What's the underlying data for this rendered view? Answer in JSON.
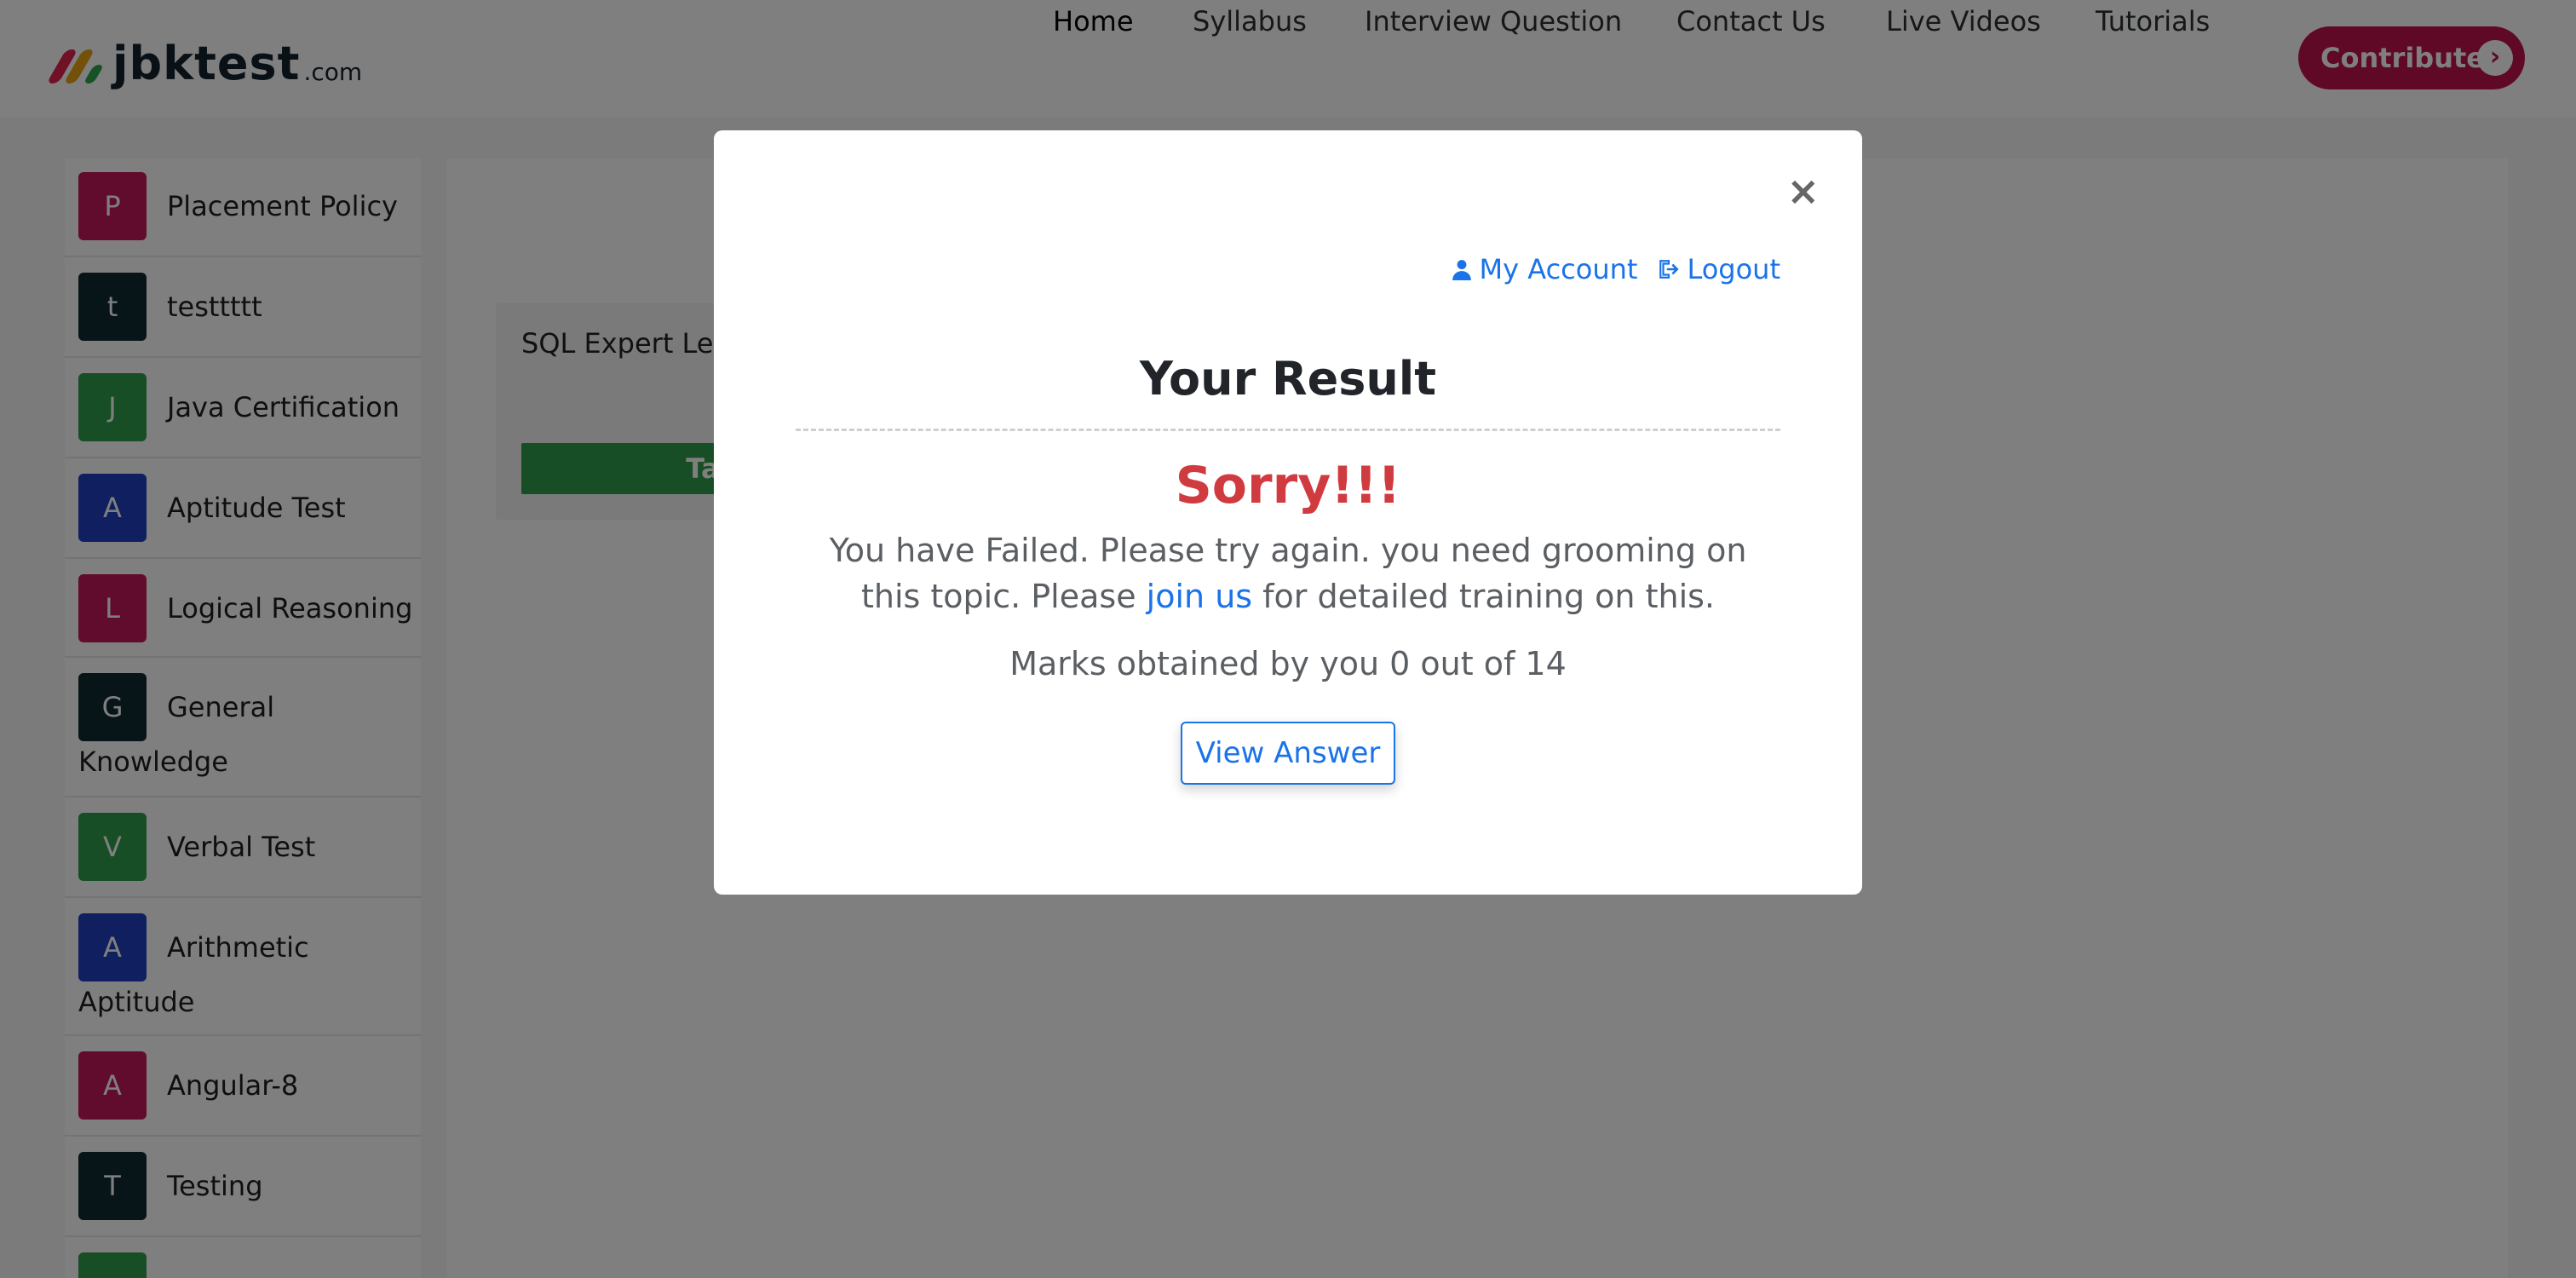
{
  "header": {
    "logo_text": "jbktest",
    "logo_domain": ".com",
    "nav": [
      {
        "label": "Home"
      },
      {
        "label": "Syllabus"
      },
      {
        "label": "Interview Question"
      },
      {
        "label": "Contact Us"
      },
      {
        "label": "Live Videos"
      },
      {
        "label": "Tutorials"
      }
    ],
    "contribute_label": "Contribute"
  },
  "sidebar": {
    "items": [
      {
        "badge": "P",
        "label": "Placement Policy",
        "color": "#c2185b"
      },
      {
        "badge": "t",
        "label": "testtttt",
        "color": "#0f2a30"
      },
      {
        "badge": "J",
        "label": "Java Certification",
        "color": "#2e9d4b"
      },
      {
        "badge": "A",
        "label": "Aptitude Test",
        "color": "#1e3fbf"
      },
      {
        "badge": "L",
        "label": "Logical Reasoning",
        "color": "#c2185b"
      },
      {
        "badge": "G",
        "label_line1": "General",
        "label_line2": "Knowledge",
        "color": "#0f2a30"
      },
      {
        "badge": "V",
        "label": "Verbal Test",
        "color": "#2e9d4b"
      },
      {
        "badge": "A",
        "label_line1": "Arithmetic",
        "label_line2": "Aptitude",
        "color": "#1e3fbf"
      },
      {
        "badge": "A",
        "label": "Angular-8",
        "color": "#c2185b"
      },
      {
        "badge": "T",
        "label": "Testing",
        "color": "#0f2a30"
      }
    ]
  },
  "main": {
    "quiz_title": "SQL Expert Leve",
    "quiz_button": "Take Qui"
  },
  "modal": {
    "close_glyph": "×",
    "my_account": "My Account",
    "logout": "Logout",
    "title": "Your Result",
    "sorry": "Sorry!!!",
    "message_before": "You have Failed. Please try again. you need grooming on this topic. Please ",
    "message_link": "join us",
    "message_after": " for detailed training on this.",
    "marks": "Marks obtained by you 0 out of 14",
    "view_answer": "View Answer"
  },
  "colors": {
    "brand": "#c0124f",
    "link": "#1a73e8",
    "fail": "#d03b40",
    "success": "#2f9c4b"
  }
}
